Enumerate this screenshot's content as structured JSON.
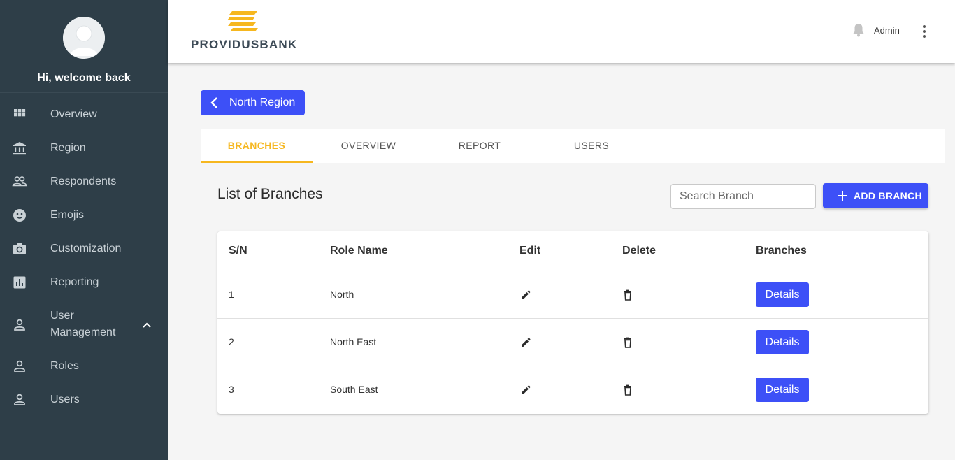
{
  "sidebar": {
    "welcome": "Hi, welcome back",
    "items": [
      {
        "label": "Overview",
        "icon": "grid-icon"
      },
      {
        "label": "Region",
        "icon": "bank-icon"
      },
      {
        "label": "Respondents",
        "icon": "people-icon"
      },
      {
        "label": "Emojis",
        "icon": "smiley-icon"
      },
      {
        "label": "Customization",
        "icon": "camera-icon"
      },
      {
        "label": "Reporting",
        "icon": "bar-chart-icon"
      },
      {
        "label_line1": "User",
        "label_line2": "Management",
        "icon": "person-icon",
        "expanded": true
      },
      {
        "label": "Roles",
        "icon": "person-icon"
      },
      {
        "label": "Users",
        "icon": "person-icon"
      }
    ]
  },
  "header": {
    "logo_text": "PROVIDUSBANK",
    "user_label": "Admin"
  },
  "region_button": {
    "label": "North Region"
  },
  "tabs": [
    {
      "label": "BRANCHES",
      "active": true
    },
    {
      "label": "OVERVIEW",
      "active": false
    },
    {
      "label": "REPORT",
      "active": false
    },
    {
      "label": "USERS",
      "active": false
    }
  ],
  "main": {
    "title": "List of Branches",
    "search_placeholder": "Search Branch",
    "add_button_label": "ADD BRANCH"
  },
  "table": {
    "headers": [
      "S/N",
      "Role Name",
      "Edit",
      "Delete",
      "Branches"
    ],
    "rows": [
      {
        "sn": "1",
        "name": "North",
        "action": "Details"
      },
      {
        "sn": "2",
        "name": "North East",
        "action": "Details"
      },
      {
        "sn": "3",
        "name": "South East",
        "action": "Details"
      }
    ]
  },
  "colors": {
    "sidebar_bg": "#2e3e48",
    "primary": "#3d50f7",
    "accent": "#f6b71f"
  }
}
